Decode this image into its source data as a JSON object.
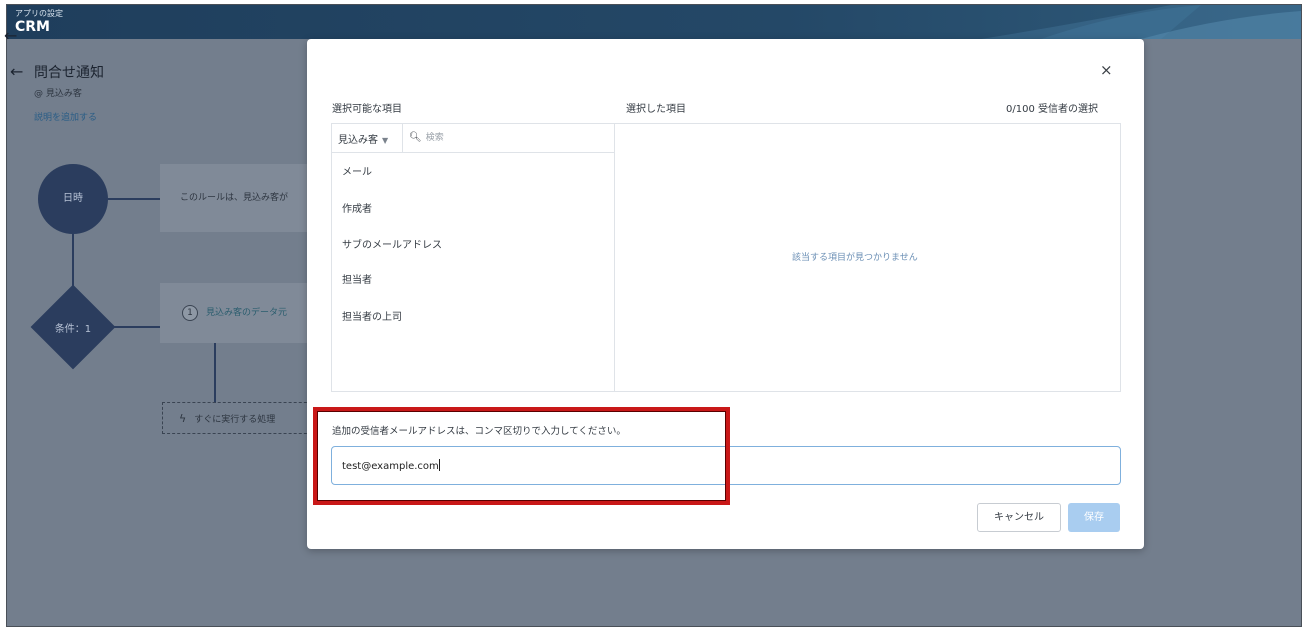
{
  "header": {
    "subtitle": "アプリの設定",
    "app_name": "CRM"
  },
  "page": {
    "back_icon": "←",
    "title": "問合せ通知",
    "subtitle": "@ 見込み客",
    "add_description": "説明を追加する"
  },
  "flow": {
    "trigger_label": "日時",
    "trigger_card": "このルールは、見込み客が",
    "condition_label": "条件：1",
    "condition_number": "1",
    "condition_card": "見込み客のデータ元",
    "action_card": "すぐに実行する処理"
  },
  "modal": {
    "close_icon": "×",
    "available_label": "選択可能な項目",
    "selected_label": "選択した項目",
    "recipient_count": "0/100 受信者の選択",
    "dropdown_value": "見込み客",
    "search_placeholder": "検索",
    "items": [
      "メール",
      "作成者",
      "サブのメールアドレス",
      "担当者",
      "担当者の上司"
    ],
    "empty_message": "該当する項目が見つかりません",
    "additional_label": "追加の受信者メールアドレスは、コンマ区切りで入力してください。",
    "email_value": "test@example.com",
    "cancel_label": "キャンセル",
    "save_label": "保存"
  },
  "colors": {
    "accent": "#a9cdf0",
    "highlight": "#c91818",
    "overlay": "#737e8d"
  }
}
